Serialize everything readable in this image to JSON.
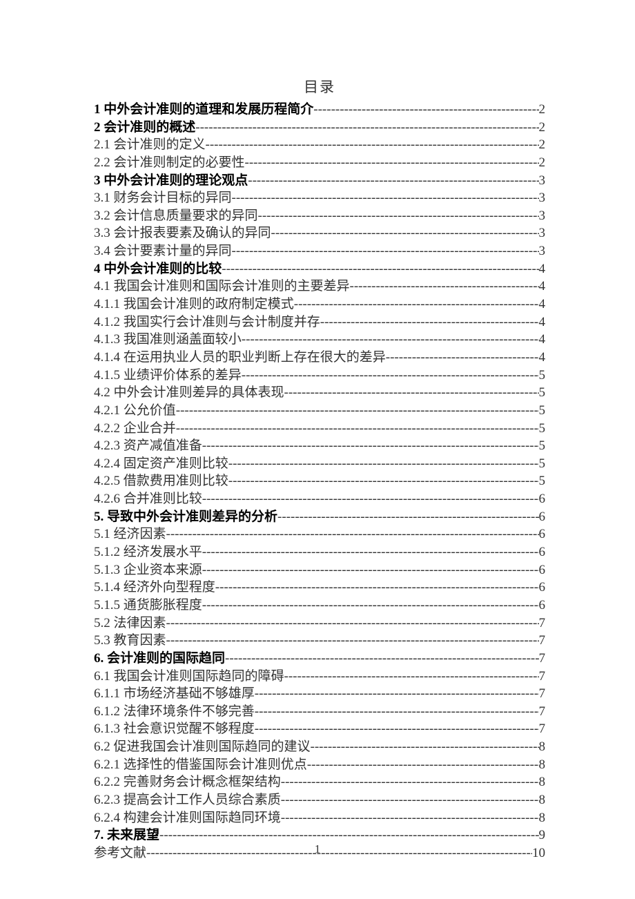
{
  "title": "目录",
  "page_number": "1",
  "entries": [
    {
      "label": "1 中外会计准则的道理和发展历程简介",
      "page": "2",
      "bold": true
    },
    {
      "label": "2 会计准则的概述",
      "page": "2",
      "bold": true
    },
    {
      "label": "2.1 会计准则的定义",
      "page": "2",
      "bold": false
    },
    {
      "label": "2.2 会计准则制定的必要性",
      "page": "2",
      "bold": false
    },
    {
      "label": "3 中外会计准则的理论观点",
      "page": "3",
      "bold": true
    },
    {
      "label": "3.1 财务会计目标的异同",
      "page": "3",
      "bold": false
    },
    {
      "label": "3.2 会计信息质量要求的异同",
      "page": "3",
      "bold": false
    },
    {
      "label": "3.3 会计报表要素及确认的异同",
      "page": "3",
      "bold": false
    },
    {
      "label": "3.4 会计要素计量的异同",
      "page": "3",
      "bold": false
    },
    {
      "label": "4 中外会计准则的比较",
      "page": "4",
      "bold": true
    },
    {
      "label": "4.1 我国会计准则和国际会计准则的主要差异",
      "page": "4",
      "bold": false
    },
    {
      "label": "4.1.1 我国会计准则的政府制定模式",
      "page": "4",
      "bold": false
    },
    {
      "label": "4.1.2 我国实行会计准则与会计制度并存",
      "page": "4",
      "bold": false
    },
    {
      "label": "4.1.3 我国准则涵盖面较小",
      "page": "4",
      "bold": false
    },
    {
      "label": "4.1.4 在运用执业人员的职业判断上存在很大的差异",
      "page": "4",
      "bold": false
    },
    {
      "label": "4.1.5 业绩评价体系的差异",
      "page": "5",
      "bold": false
    },
    {
      "label": "4.2 中外会计准则差异的具体表现",
      "page": "5",
      "bold": false
    },
    {
      "label": "4.2.1 公允价值",
      "page": "5",
      "bold": false
    },
    {
      "label": "4.2.2 企业合并",
      "page": "5",
      "bold": false
    },
    {
      "label": "4.2.3 资产减值准备",
      "page": "5",
      "bold": false
    },
    {
      "label": "4.2.4 固定资产准则比较",
      "page": "5",
      "bold": false
    },
    {
      "label": "4.2.5 借款费用准则比较",
      "page": "5",
      "bold": false
    },
    {
      "label": "4.2.6 合并准则比较",
      "page": "6",
      "bold": false
    },
    {
      "label": "5. 导致中外会计准则差异的分析",
      "page": "6",
      "bold": true
    },
    {
      "label": "5.1 经济因素",
      "page": "6",
      "bold": false
    },
    {
      "label": "5.1.2 经济发展水平",
      "page": "6",
      "bold": false
    },
    {
      "label": "5.1.3 企业资本来源",
      "page": "6",
      "bold": false
    },
    {
      "label": "5.1.4 经济外向型程度",
      "page": "6",
      "bold": false
    },
    {
      "label": "5.1.5 通货膨胀程度",
      "page": "6",
      "bold": false
    },
    {
      "label": "5.2 法律因素",
      "page": "7",
      "bold": false
    },
    {
      "label": "5.3 教育因素",
      "page": "7",
      "bold": false
    },
    {
      "label": "6. 会计准则的国际趋同",
      "page": "7",
      "bold": true
    },
    {
      "label": "6.1 我国会计准则国际趋同的障碍",
      "page": "7",
      "bold": false
    },
    {
      "label": "6.1.1 市场经济基础不够雄厚",
      "page": "7",
      "bold": false
    },
    {
      "label": "6.1.2 法律环境条件不够完善",
      "page": "7",
      "bold": false
    },
    {
      "label": "6.1.3 社会意识觉醒不够程度",
      "page": "7",
      "bold": false
    },
    {
      "label": "6.2 促进我国会计准则国际趋同的建议",
      "page": "8",
      "bold": false
    },
    {
      "label": "6.2.1 选择性的借鉴国际会计准则优点",
      "page": "8",
      "bold": false
    },
    {
      "label": "6.2.2 完善财务会计概念框架结构",
      "page": "8",
      "bold": false
    },
    {
      "label": "6.2.3 提高会计工作人员综合素质",
      "page": "8",
      "bold": false
    },
    {
      "label": "6.2.4 构建会计准则国际趋同环境",
      "page": "8",
      "bold": false
    },
    {
      "label": "7. 未来展望",
      "page": "9",
      "bold": true
    },
    {
      "label": "参考文献",
      "page": "10",
      "bold": false
    }
  ]
}
